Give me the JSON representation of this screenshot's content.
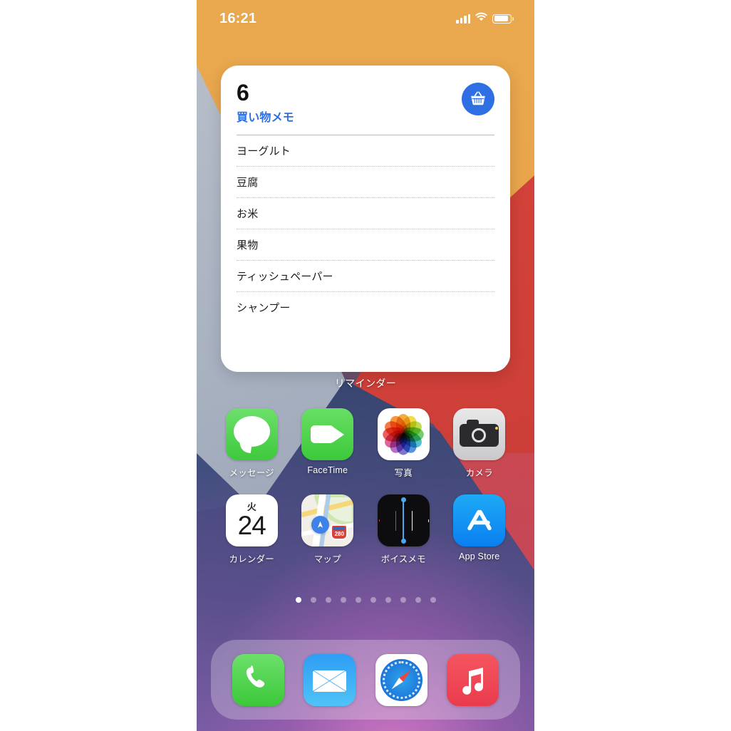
{
  "status_bar": {
    "time": "16:21",
    "icons": [
      "cellular-signal-icon",
      "wifi-icon",
      "battery-icon"
    ]
  },
  "widget": {
    "app_label": "リマインダー",
    "count": "6",
    "list_title": "買い物メモ",
    "badge_icon": "shopping-basket-icon",
    "accent_color": "#2f6fe4",
    "items": [
      "ヨーグルト",
      "豆腐",
      "お米",
      "果物",
      "ティッシュペーパー",
      "シャンプー"
    ]
  },
  "home_screen": {
    "rows": [
      {
        "apps": [
          {
            "label": "メッセージ",
            "icon": "messages-icon"
          },
          {
            "label": "FaceTime",
            "icon": "facetime-icon"
          },
          {
            "label": "写真",
            "icon": "photos-icon"
          },
          {
            "label": "カメラ",
            "icon": "camera-icon"
          }
        ]
      },
      {
        "apps": [
          {
            "label": "カレンダー",
            "icon": "calendar-icon",
            "day_of_week": "火",
            "day": "24"
          },
          {
            "label": "マップ",
            "icon": "maps-icon",
            "route_shield": "280"
          },
          {
            "label": "ボイスメモ",
            "icon": "voice-memos-icon"
          },
          {
            "label": "App Store",
            "icon": "app-store-icon"
          }
        ]
      }
    ],
    "page_dots": {
      "total": 10,
      "active_index": 0
    }
  },
  "dock": {
    "apps": [
      {
        "label": "電話",
        "icon": "phone-icon"
      },
      {
        "label": "メール",
        "icon": "mail-icon"
      },
      {
        "label": "Safari",
        "icon": "safari-icon"
      },
      {
        "label": "ミュージック",
        "icon": "music-icon"
      }
    ]
  }
}
